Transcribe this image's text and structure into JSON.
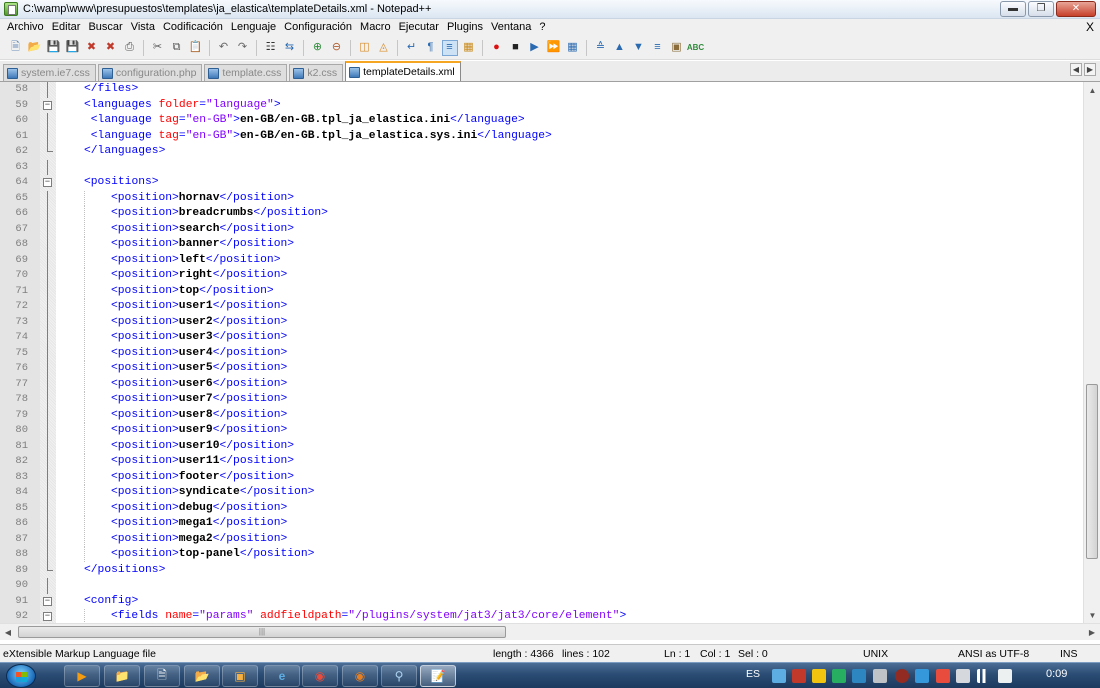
{
  "window": {
    "title": "C:\\wamp\\www\\presupuestos\\templates\\ja_elastica\\templateDetails.xml - Notepad++"
  },
  "menu": [
    "Archivo",
    "Editar",
    "Buscar",
    "Vista",
    "Codificación",
    "Lenguaje",
    "Configuración",
    "Macro",
    "Ejecutar",
    "Plugins",
    "Ventana",
    "?"
  ],
  "menu_close": "X",
  "toolbar_icons": [
    "new-file-icon",
    "open-file-icon",
    "save-icon",
    "save-all-icon",
    "close-icon",
    "close-all-icon",
    "print-icon",
    "cut-icon",
    "copy-icon",
    "paste-icon",
    "undo-icon",
    "redo-icon",
    "find-icon",
    "replace-icon",
    "zoom-in-icon",
    "zoom-out-icon",
    "sync-vertical-icon",
    "sync-horizontal-icon",
    "word-wrap-icon",
    "show-all-chars-icon",
    "indent-guide-icon",
    "doc-map-icon",
    "record-macro-icon",
    "stop-macro-icon",
    "play-macro-icon",
    "run-macro-multiple-icon",
    "save-macro-icon",
    "collapse-icon",
    "prev-bookmark-icon",
    "next-bookmark-icon",
    "toggle-bookmark-icon",
    "launch-browser-icon",
    "spell-check-icon"
  ],
  "tabs": [
    {
      "label": "system.ie7.css",
      "active": false
    },
    {
      "label": "configuration.php",
      "active": false
    },
    {
      "label": "template.css",
      "active": false
    },
    {
      "label": "k2.css",
      "active": false
    },
    {
      "label": "templateDetails.xml",
      "active": true
    }
  ],
  "editor": {
    "lines": [
      {
        "n": "58",
        "fold": "line",
        "indent": 1,
        "parts": [
          [
            "tag",
            "</files>"
          ]
        ]
      },
      {
        "n": "59",
        "fold": "box",
        "indent": 1,
        "parts": [
          [
            "tag",
            "<languages "
          ],
          [
            "attr",
            "folder"
          ],
          [
            "tag",
            "="
          ],
          [
            "val",
            "\"language\""
          ],
          [
            "tag",
            ">"
          ]
        ]
      },
      {
        "n": "60",
        "fold": "line",
        "indent": 1,
        "pre": " ",
        "parts": [
          [
            "tag",
            "<language "
          ],
          [
            "attr",
            "tag"
          ],
          [
            "tag",
            "="
          ],
          [
            "val",
            "\"en-GB\""
          ],
          [
            "tag",
            ">"
          ],
          [
            "txt",
            "en-GB/en-GB.tpl_ja_elastica.ini"
          ],
          [
            "tag",
            "</language>"
          ]
        ]
      },
      {
        "n": "61",
        "fold": "line",
        "indent": 1,
        "pre": " ",
        "parts": [
          [
            "tag",
            "<language "
          ],
          [
            "attr",
            "tag"
          ],
          [
            "tag",
            "="
          ],
          [
            "val",
            "\"en-GB\""
          ],
          [
            "tag",
            ">"
          ],
          [
            "txt",
            "en-GB/en-GB.tpl_ja_elastica.sys.ini"
          ],
          [
            "tag",
            "</language>"
          ]
        ]
      },
      {
        "n": "62",
        "fold": "end",
        "indent": 1,
        "parts": [
          [
            "tag",
            "</languages>"
          ]
        ]
      },
      {
        "n": "63",
        "fold": "line",
        "indent": 0,
        "parts": []
      },
      {
        "n": "64",
        "fold": "box",
        "indent": 1,
        "parts": [
          [
            "tag",
            "<positions>"
          ]
        ]
      },
      {
        "n": "65",
        "fold": "line",
        "indent": 2,
        "parts": [
          [
            "tag",
            "<position>"
          ],
          [
            "txt",
            "hornav"
          ],
          [
            "tag",
            "</position>"
          ]
        ]
      },
      {
        "n": "66",
        "fold": "line",
        "indent": 2,
        "parts": [
          [
            "tag",
            "<position>"
          ],
          [
            "txt",
            "breadcrumbs"
          ],
          [
            "tag",
            "</position>"
          ]
        ]
      },
      {
        "n": "67",
        "fold": "line",
        "indent": 2,
        "parts": [
          [
            "tag",
            "<position>"
          ],
          [
            "txt",
            "search"
          ],
          [
            "tag",
            "</position>"
          ]
        ]
      },
      {
        "n": "68",
        "fold": "line",
        "indent": 2,
        "parts": [
          [
            "tag",
            "<position>"
          ],
          [
            "txt",
            "banner"
          ],
          [
            "tag",
            "</position>"
          ]
        ]
      },
      {
        "n": "69",
        "fold": "line",
        "indent": 2,
        "parts": [
          [
            "tag",
            "<position>"
          ],
          [
            "txt",
            "left"
          ],
          [
            "tag",
            "</position>"
          ]
        ]
      },
      {
        "n": "70",
        "fold": "line",
        "indent": 2,
        "parts": [
          [
            "tag",
            "<position>"
          ],
          [
            "txt",
            "right"
          ],
          [
            "tag",
            "</position>"
          ]
        ]
      },
      {
        "n": "71",
        "fold": "line",
        "indent": 2,
        "parts": [
          [
            "tag",
            "<position>"
          ],
          [
            "txt",
            "top"
          ],
          [
            "tag",
            "</position>"
          ]
        ]
      },
      {
        "n": "72",
        "fold": "line",
        "indent": 2,
        "parts": [
          [
            "tag",
            "<position>"
          ],
          [
            "txt",
            "user1"
          ],
          [
            "tag",
            "</position>"
          ]
        ]
      },
      {
        "n": "73",
        "fold": "line",
        "indent": 2,
        "parts": [
          [
            "tag",
            "<position>"
          ],
          [
            "txt",
            "user2"
          ],
          [
            "tag",
            "</position>"
          ]
        ]
      },
      {
        "n": "74",
        "fold": "line",
        "indent": 2,
        "parts": [
          [
            "tag",
            "<position>"
          ],
          [
            "txt",
            "user3"
          ],
          [
            "tag",
            "</position>"
          ]
        ]
      },
      {
        "n": "75",
        "fold": "line",
        "indent": 2,
        "parts": [
          [
            "tag",
            "<position>"
          ],
          [
            "txt",
            "user4"
          ],
          [
            "tag",
            "</position>"
          ]
        ]
      },
      {
        "n": "76",
        "fold": "line",
        "indent": 2,
        "parts": [
          [
            "tag",
            "<position>"
          ],
          [
            "txt",
            "user5"
          ],
          [
            "tag",
            "</position>"
          ]
        ]
      },
      {
        "n": "77",
        "fold": "line",
        "indent": 2,
        "parts": [
          [
            "tag",
            "<position>"
          ],
          [
            "txt",
            "user6"
          ],
          [
            "tag",
            "</position>"
          ]
        ]
      },
      {
        "n": "78",
        "fold": "line",
        "indent": 2,
        "parts": [
          [
            "tag",
            "<position>"
          ],
          [
            "txt",
            "user7"
          ],
          [
            "tag",
            "</position>"
          ]
        ]
      },
      {
        "n": "79",
        "fold": "line",
        "indent": 2,
        "parts": [
          [
            "tag",
            "<position>"
          ],
          [
            "txt",
            "user8"
          ],
          [
            "tag",
            "</position>"
          ]
        ]
      },
      {
        "n": "80",
        "fold": "line",
        "indent": 2,
        "parts": [
          [
            "tag",
            "<position>"
          ],
          [
            "txt",
            "user9"
          ],
          [
            "tag",
            "</position>"
          ]
        ]
      },
      {
        "n": "81",
        "fold": "line",
        "indent": 2,
        "parts": [
          [
            "tag",
            "<position>"
          ],
          [
            "txt",
            "user10"
          ],
          [
            "tag",
            "</position>"
          ]
        ]
      },
      {
        "n": "82",
        "fold": "line",
        "indent": 2,
        "parts": [
          [
            "tag",
            "<position>"
          ],
          [
            "txt",
            "user11"
          ],
          [
            "tag",
            "</position>"
          ]
        ]
      },
      {
        "n": "83",
        "fold": "line",
        "indent": 2,
        "parts": [
          [
            "tag",
            "<position>"
          ],
          [
            "txt",
            "footer"
          ],
          [
            "tag",
            "</position>"
          ]
        ]
      },
      {
        "n": "84",
        "fold": "line",
        "indent": 2,
        "parts": [
          [
            "tag",
            "<position>"
          ],
          [
            "txt",
            "syndicate"
          ],
          [
            "tag",
            "</position>"
          ]
        ]
      },
      {
        "n": "85",
        "fold": "line",
        "indent": 2,
        "parts": [
          [
            "tag",
            "<position>"
          ],
          [
            "txt",
            "debug"
          ],
          [
            "tag",
            "</position>"
          ]
        ]
      },
      {
        "n": "86",
        "fold": "line",
        "indent": 2,
        "parts": [
          [
            "tag",
            "<position>"
          ],
          [
            "txt",
            "mega1"
          ],
          [
            "tag",
            "</position>"
          ]
        ]
      },
      {
        "n": "87",
        "fold": "line",
        "indent": 2,
        "parts": [
          [
            "tag",
            "<position>"
          ],
          [
            "txt",
            "mega2"
          ],
          [
            "tag",
            "</position>"
          ]
        ]
      },
      {
        "n": "88",
        "fold": "line",
        "indent": 2,
        "parts": [
          [
            "tag",
            "<position>"
          ],
          [
            "txt",
            "top-panel"
          ],
          [
            "tag",
            "</position>"
          ]
        ]
      },
      {
        "n": "89",
        "fold": "end",
        "indent": 1,
        "parts": [
          [
            "tag",
            "</positions>"
          ]
        ]
      },
      {
        "n": "90",
        "fold": "line",
        "indent": 0,
        "parts": []
      },
      {
        "n": "91",
        "fold": "box",
        "indent": 1,
        "parts": [
          [
            "tag",
            "<config>"
          ]
        ]
      },
      {
        "n": "92",
        "fold": "box",
        "indent": 2,
        "parts": [
          [
            "tag",
            "<fields "
          ],
          [
            "attr",
            "name"
          ],
          [
            "tag",
            "="
          ],
          [
            "val",
            "\"params\""
          ],
          [
            "tag",
            " "
          ],
          [
            "attr",
            "addfieldpath"
          ],
          [
            "tag",
            "="
          ],
          [
            "val",
            "\"/plugins/system/jat3/jat3/core/element\""
          ],
          [
            "tag",
            ">"
          ]
        ]
      }
    ]
  },
  "statusbar": {
    "file_type": "eXtensible Markup Language file",
    "length": "length : 4366",
    "lines": "lines : 102",
    "ln": "Ln : 1",
    "col": "Col : 1",
    "sel": "Sel : 0",
    "eol": "UNIX",
    "encoding": "ANSI as UTF-8",
    "mode": "INS"
  },
  "taskbar": {
    "language": "ES",
    "clock": "0:09"
  }
}
